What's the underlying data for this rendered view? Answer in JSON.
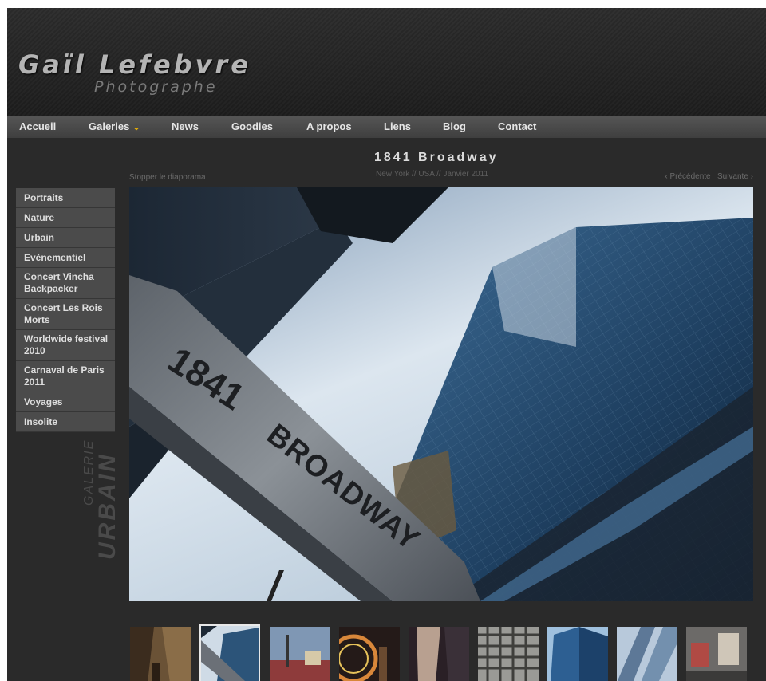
{
  "site": {
    "logo_name": "Gaïl Lefebvre",
    "logo_sub": "Photographe"
  },
  "nav": {
    "items": [
      "Accueil",
      "Galeries",
      "News",
      "Goodies",
      "A propos",
      "Liens",
      "Blog",
      "Contact"
    ],
    "dropdown_icon": "chevron-down-icon",
    "accent_color": "#f0b400"
  },
  "photo": {
    "title": "1841 Broadway",
    "subtitle": "New York // USA // Janvier 2011",
    "sign_text_number": "1841",
    "sign_text_street": "BROADWAY"
  },
  "slideshow": {
    "stop_label": "Stopper le diaporama",
    "prev_label": "‹ Précédente",
    "next_label": "Suivante ›"
  },
  "sidebar": {
    "items": [
      "Portraits",
      "Nature",
      "Urbain",
      "Evènementiel",
      "Concert Vincha Backpacker",
      "Concert Les Rois Morts",
      "Worldwide festival 2010",
      "Carnaval de Paris 2011",
      "Voyages",
      "Insolite"
    ],
    "gallery_label_small": "GALERIE",
    "gallery_label_big": "URBAIN"
  },
  "thumbnails": {
    "active_index": 1,
    "count": 9
  }
}
